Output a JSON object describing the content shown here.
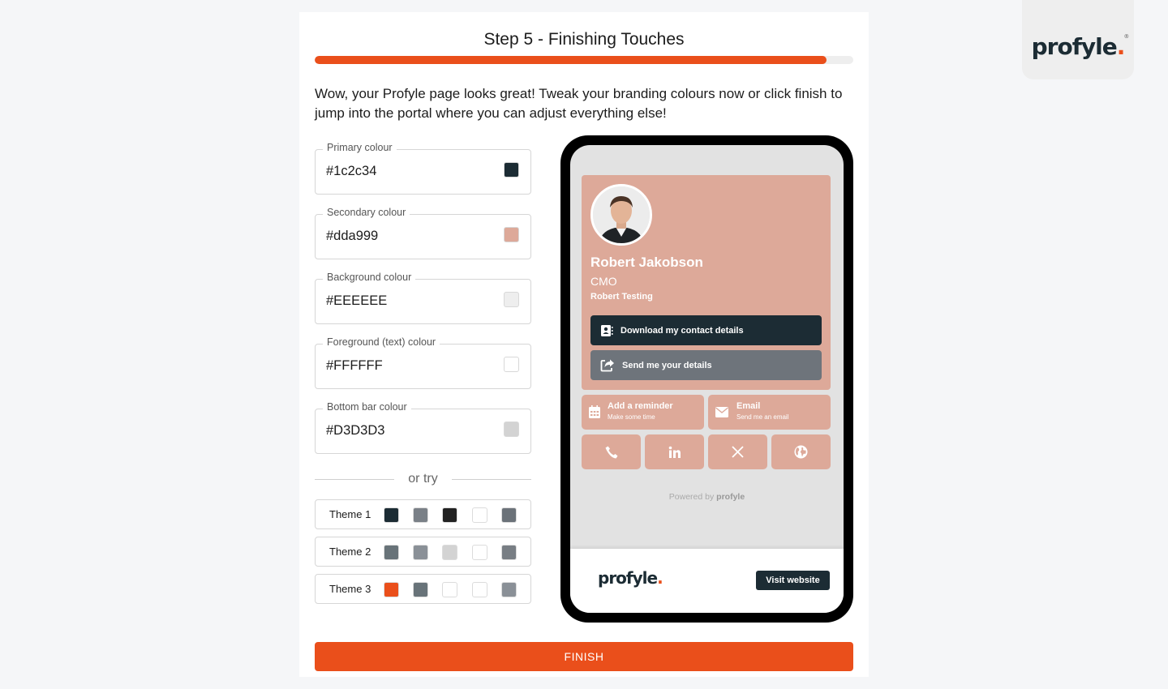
{
  "brand": {
    "logo_text": "profyle",
    "logo_dot": ".",
    "logo_reg": "®",
    "accent_color": "#ea4f1b"
  },
  "wizard": {
    "title": "Step 5 - Finishing Touches",
    "progress_percent": 95,
    "intro": "Wow, your Profyle page looks great! Tweak your branding colours now or click finish to jump into the portal where you can adjust everything else!"
  },
  "fields": [
    {
      "label": "Primary colour",
      "value": "#1c2c34",
      "swatch": "#1c2c34"
    },
    {
      "label": "Secondary colour",
      "value": "#dda999",
      "swatch": "#dda999"
    },
    {
      "label": "Background colour",
      "value": "#EEEEEE",
      "swatch": "#EEEEEE"
    },
    {
      "label": "Foreground (text) colour",
      "value": "#FFFFFF",
      "swatch": "#FFFFFF"
    },
    {
      "label": "Bottom bar colour",
      "value": "#D3D3D3",
      "swatch": "#D3D3D3"
    }
  ],
  "or_try": "or try",
  "themes": [
    {
      "name": "Theme 1",
      "colors": [
        "#1c2c34",
        "#7a8087",
        "#222222",
        "#ffffff",
        "#6b7279"
      ]
    },
    {
      "name": "Theme 2",
      "colors": [
        "#687379",
        "#8a9097",
        "#d3d3d3",
        "#ffffff",
        "#787e84"
      ]
    },
    {
      "name": "Theme 3",
      "colors": [
        "#ea4f1b",
        "#687379",
        "#ffffff",
        "#ffffff",
        "#8a9097"
      ]
    }
  ],
  "preview": {
    "name": "Robert Jakobson",
    "role": "CMO",
    "company": "Robert Testing",
    "download_label": "Download my contact details",
    "send_label": "Send me your details",
    "reminder_title": "Add a reminder",
    "reminder_sub": "Make some time",
    "email_title": "Email",
    "email_sub": "Send me an email",
    "powered_by": "Powered by",
    "powered_brand": "profyle",
    "bottom_logo": "profyle",
    "bottom_logo_dot": ".",
    "visit_label": "Visit website"
  },
  "finish_label": "FINISH"
}
